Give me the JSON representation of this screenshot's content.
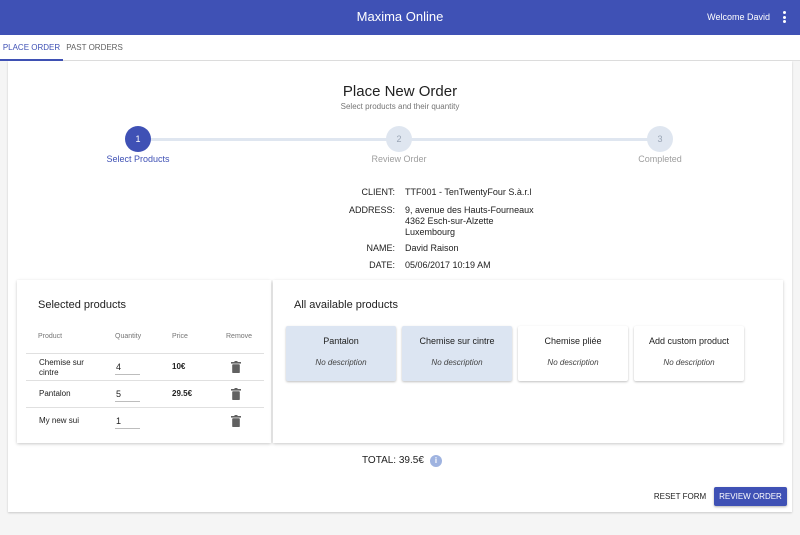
{
  "app": {
    "title": "Maxima Online",
    "welcome": "Welcome David"
  },
  "tabs": [
    {
      "label": "PLACE ORDER",
      "active": true
    },
    {
      "label": "PAST ORDERS",
      "active": false
    }
  ],
  "header": {
    "title": "Place New Order",
    "subtitle": "Select products and their quantity"
  },
  "stepper": {
    "steps": [
      {
        "number": "1",
        "label": "Select Products",
        "active": true
      },
      {
        "number": "2",
        "label": "Review Order",
        "active": false
      },
      {
        "number": "3",
        "label": "Completed",
        "active": false
      }
    ]
  },
  "client_info": {
    "client_label": "CLIENT:",
    "client_value": "TTF001 - TenTwentyFour S.à.r.l",
    "address_label": "ADDRESS:",
    "address_lines": [
      "9, avenue des Hauts-Fourneaux",
      "4362 Esch-sur-Alzette",
      "Luxembourg"
    ],
    "name_label": "NAME:",
    "name_value": "David Raison",
    "date_label": "DATE:",
    "date_value": "05/06/2017 10:19 AM"
  },
  "selected_products": {
    "title": "Selected products",
    "headers": {
      "product": "Product",
      "quantity": "Quantity",
      "price": "Price",
      "remove": "Remove"
    },
    "rows": [
      {
        "product": "Chemise sur cintre",
        "quantity": "4",
        "price": "10€"
      },
      {
        "product": "Pantalon",
        "quantity": "5",
        "price": "29.5€"
      },
      {
        "product": "My new sui",
        "quantity": "1",
        "price": ""
      }
    ]
  },
  "available_products": {
    "title": "All available products",
    "items": [
      {
        "name": "Pantalon",
        "description": "No description",
        "selected": true
      },
      {
        "name": "Chemise sur cintre",
        "description": "No description",
        "selected": true
      },
      {
        "name": "Chemise pliée",
        "description": "No description",
        "selected": false
      },
      {
        "name": "Add custom product",
        "description": "No description",
        "selected": false
      }
    ]
  },
  "total": {
    "label": "TOTAL: 39.5€",
    "info_icon": "info-icon"
  },
  "actions": {
    "reset": "RESET FORM",
    "review": "REVIEW ORDER"
  },
  "colors": {
    "primary": "#3f51b5",
    "selected_card": "#dce5f2",
    "step_inactive": "#dfe6f0"
  }
}
